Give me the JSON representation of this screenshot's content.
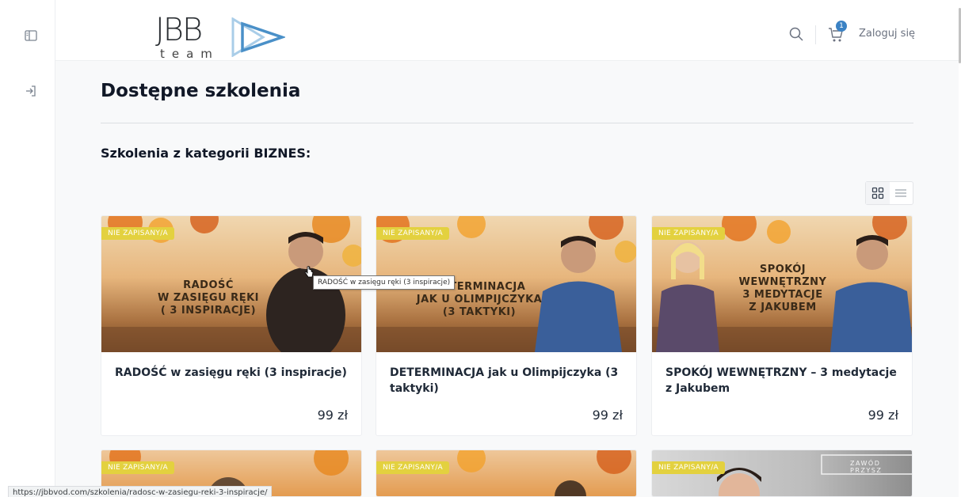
{
  "header": {
    "logo_text": "JBB",
    "logo_sub": "team",
    "login_label": "Zaloguj się",
    "cart_count": "1"
  },
  "main": {
    "page_title": "Dostępne szkolenia",
    "category_title": "Szkolenia z kategorii BIZNES:"
  },
  "courses": [
    {
      "badge": "NIE ZAPISANY/A",
      "title": "RADOŚĆ w zasięgu ręki (3 inspiracje)",
      "price": "99 zł",
      "thumb_caption": [
        "RADOŚĆ",
        "W ZASIĘGU RĘKI",
        "( 3 INSPIRACJE)"
      ]
    },
    {
      "badge": "NIE ZAPISANY/A",
      "title": "DETERMINACJA jak u Olimpijczyka (3 taktyki)",
      "price": "99 zł",
      "thumb_caption": [
        "DETERMINACJA",
        "JAK U OLIMPIJCZYKA",
        "(3 TAKTYKI)"
      ]
    },
    {
      "badge": "NIE ZAPISANY/A",
      "title": "SPOKÓJ WEWNĘTRZNY – 3 medytacje z Jakubem",
      "price": "99 zł",
      "thumb_caption": [
        "SPOKÓJ",
        "WEWNĘTRZNY",
        "3 MEDYTACJE",
        "Z JAKUBEM"
      ]
    }
  ],
  "more_courses": [
    {
      "badge": "NIE ZAPISANY/A"
    },
    {
      "badge": "NIE ZAPISANY/A"
    },
    {
      "badge": "NIE ZAPISANY/A",
      "thumb_text": "ZAWÓD PRZYSZ"
    }
  ],
  "tooltip": "RADOŚĆ w zasięgu ręki (3 inspiracje)",
  "status_url": "https://jbbvod.com/szkolenia/radosc-w-zasiegu-reki-3-inspiracje/",
  "colors": {
    "badge": "#e3d13f",
    "accent": "#3b82c4",
    "logo_arrow": "#4a90c8"
  }
}
